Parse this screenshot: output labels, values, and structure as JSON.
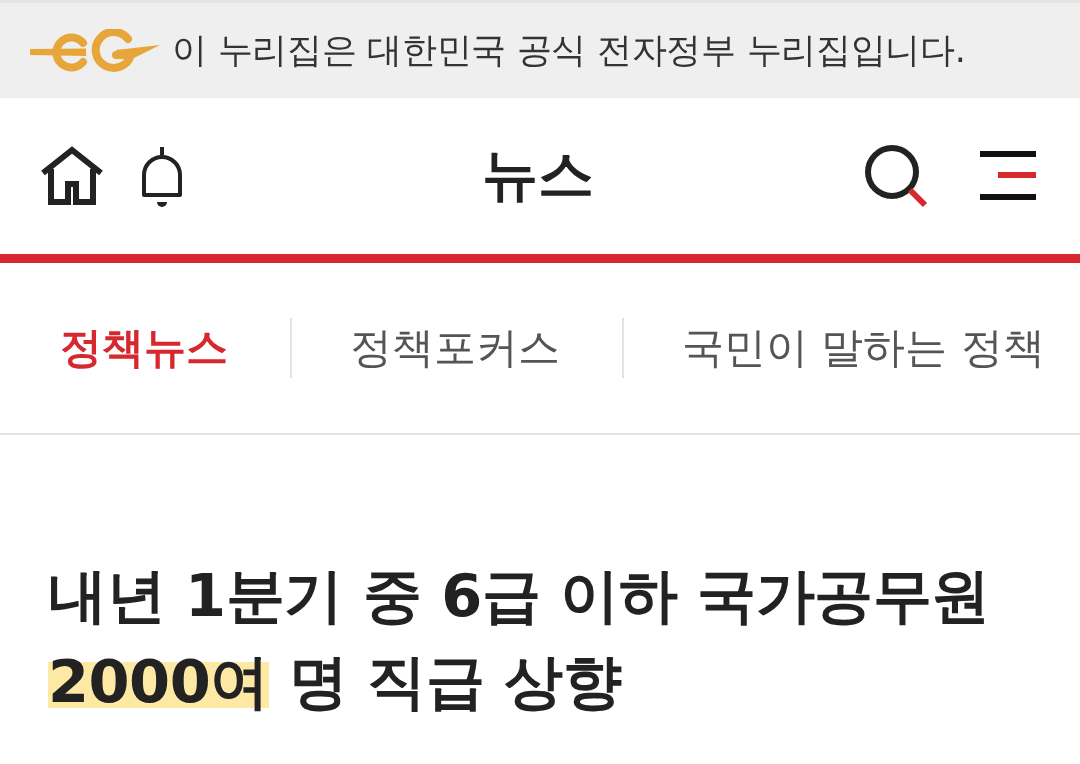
{
  "banner": {
    "text": "이 누리집은 대한민국 공식 전자정부 누리집입니다."
  },
  "header": {
    "title": "뉴스"
  },
  "tabs": [
    {
      "label": "정책뉴스",
      "selected": true
    },
    {
      "label": "정책포커스",
      "selected": false
    },
    {
      "label": "국민이 말하는 정책",
      "selected": false
    }
  ],
  "headline": {
    "segments": [
      {
        "text": "내년 1분기 중 6급 이하 국가공무원 ",
        "highlighted": false
      },
      {
        "text": "2000여",
        "highlighted": true
      },
      {
        "text": " 명 직급 상향",
        "highlighted": false
      }
    ]
  }
}
